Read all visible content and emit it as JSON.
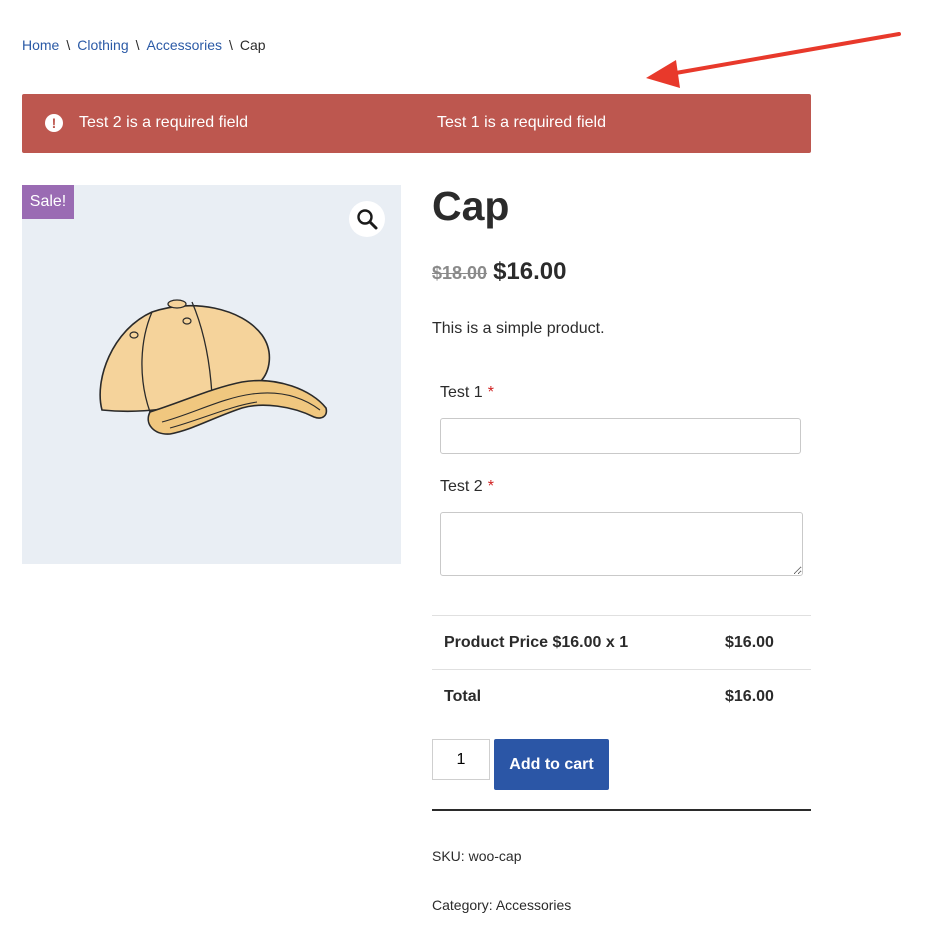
{
  "breadcrumb": {
    "items": [
      "Home",
      "Clothing",
      "Accessories"
    ],
    "current": "Cap",
    "separator": "\\"
  },
  "notice": {
    "messages": [
      "Test 2 is a required field",
      "Test 1 is a required field"
    ],
    "icon": "exclamation-circle-icon",
    "color": "#bd574f"
  },
  "annotation": {
    "icon": "red-arrow",
    "color": "#e8392b"
  },
  "gallery": {
    "sale_badge": "Sale!",
    "zoom_icon": "magnifier-icon",
    "image": "cap-illustration"
  },
  "product": {
    "title": "Cap",
    "price_old": "$18.00",
    "price_new": "$16.00",
    "description": "This is a simple product."
  },
  "fields": [
    {
      "label": "Test 1",
      "required_mark": "*",
      "value": ""
    },
    {
      "label": "Test 2",
      "required_mark": "*",
      "value": ""
    }
  ],
  "price_table": {
    "rows": [
      {
        "label": "Product Price $16.00 x 1",
        "value": "$16.00"
      },
      {
        "label": "Total",
        "value": "$16.00"
      }
    ]
  },
  "cart": {
    "quantity": "1",
    "add_label": "Add to cart",
    "button_color": "#2b56a6"
  },
  "meta": {
    "sku_label": "SKU:",
    "sku": "woo-cap",
    "category_label": "Category:",
    "category": "Accessories"
  }
}
